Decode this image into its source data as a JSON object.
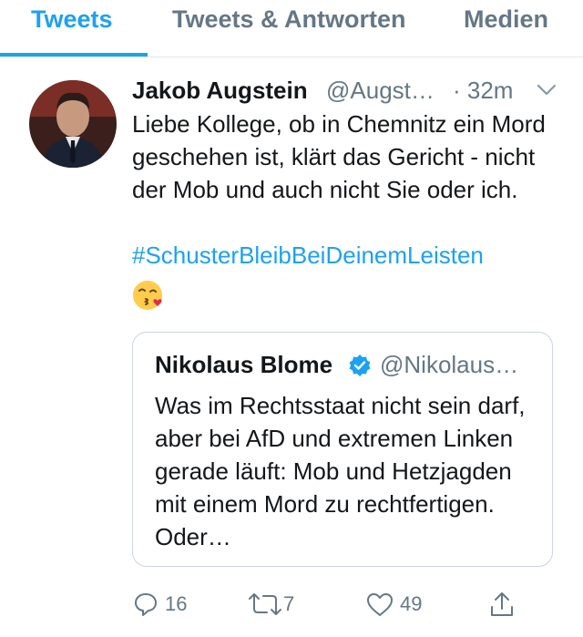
{
  "tabs": [
    {
      "label": "Tweets"
    },
    {
      "label": "Tweets & Antworten"
    },
    {
      "label": "Medien"
    }
  ],
  "tweet": {
    "author_name": "Jakob Augstein",
    "author_handle": "@Augst…",
    "time": "· 32m",
    "text": "Liebe Kollege, ob in Chemnitz ein Mord geschehen ist, klärt das Gericht - nicht der Mob und auch nicht Sie oder ich.",
    "hashtag": "#SchusterBleibBeiDeinemLeisten",
    "emoji": "😘",
    "quoted": {
      "author_name": "Nikolaus Blome",
      "author_handle": "@Nikolaus…",
      "text": "Was im Rechtsstaat nicht sein darf, aber bei AfD und extremen Linken gerade läuft: Mob und Hetzjagden mit einem Mord zu rechtfertigen. Oder…"
    },
    "actions": {
      "replies": "16",
      "retweets": "7",
      "likes": "49"
    }
  },
  "colors": {
    "accent": "#1da1f2",
    "secondary_text": "#657786",
    "border": "#ccd6dd"
  },
  "icons": [
    "chevron-down-icon",
    "verified-badge-icon",
    "reply-icon",
    "retweet-icon",
    "like-icon",
    "share-icon"
  ]
}
